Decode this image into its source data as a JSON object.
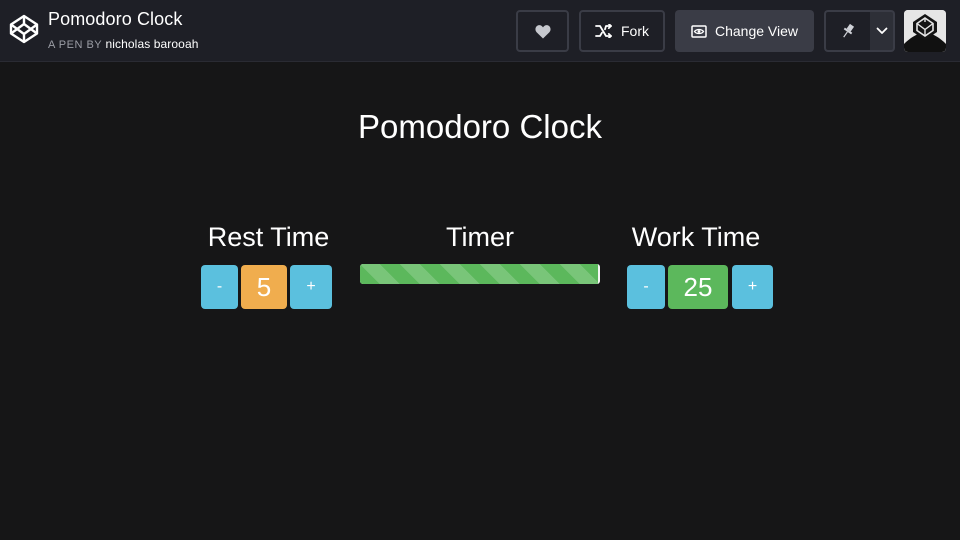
{
  "header": {
    "pen_title": "Pomodoro Clock",
    "pen_by_label": "A PEN BY",
    "author": "nicholas barooah",
    "buttons": {
      "heart_icon": "heart-icon",
      "fork_label": "Fork",
      "fork_icon": "fork-icon",
      "change_view_label": "Change View",
      "change_view_icon": "eye-icon",
      "pin_icon": "pin-icon",
      "caret_icon": "chevron-down-icon"
    }
  },
  "app": {
    "title": "Pomodoro Clock",
    "rest": {
      "label": "Rest Time",
      "minus": "-",
      "value": "5",
      "plus": "+"
    },
    "timer": {
      "label": "Timer",
      "progress": 0.99
    },
    "work": {
      "label": "Work Time",
      "minus": "-",
      "value": "25",
      "plus": "+"
    }
  },
  "colors": {
    "info": "#5bc0de",
    "warning": "#f0ad4e",
    "success": "#5cb85c",
    "background": "#161617",
    "header": "#1e1f26"
  }
}
